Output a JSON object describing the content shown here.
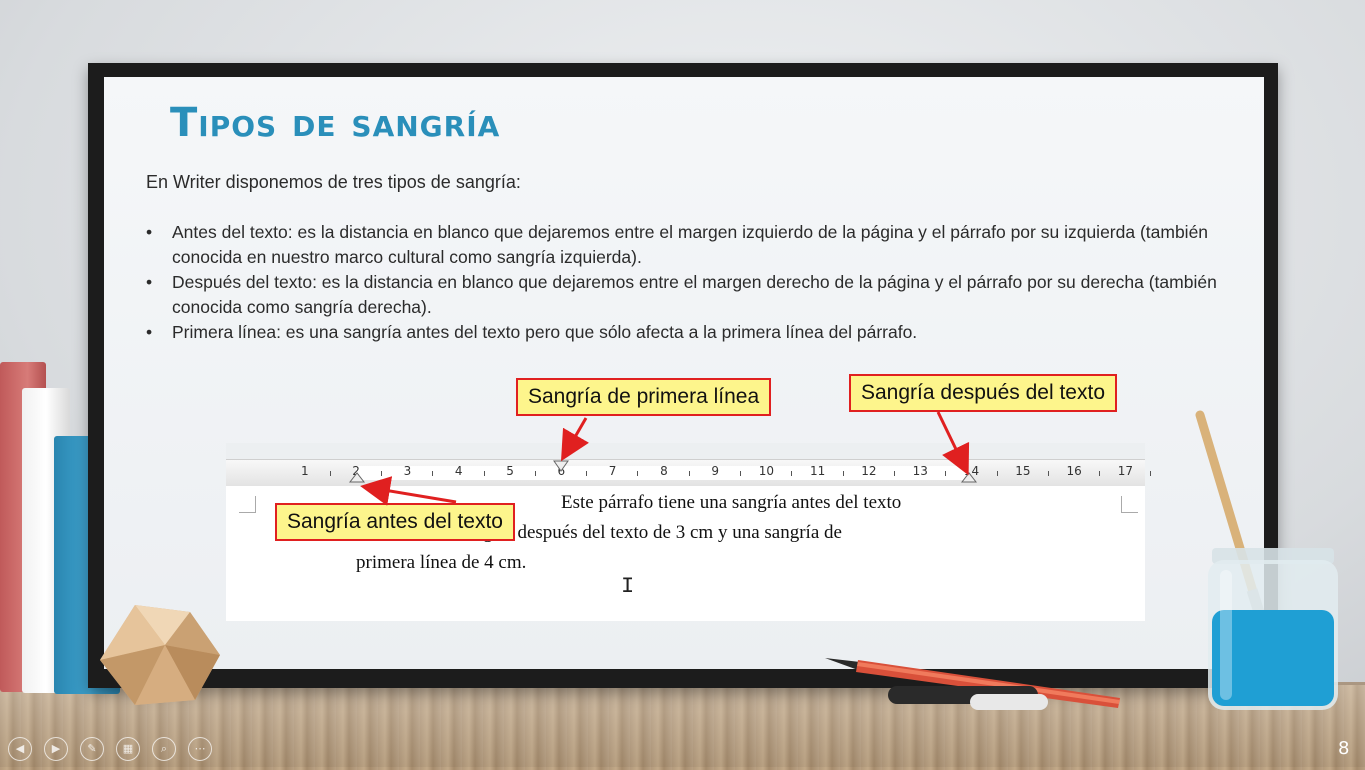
{
  "slide": {
    "title": "Tipos de sangría",
    "intro": "En Writer disponemos de tres tipos de sangría:",
    "bullets": [
      "Antes del texto: es la distancia en blanco que dejaremos entre el margen izquierdo de la página y el párrafo por su izquierda (también conocida en nuestro marco cultural como sangría izquierda).",
      "Después del texto: es la distancia en blanco que dejaremos entre el margen derecho de la página y el párrafo por su derecha (también conocida como sangría derecha).",
      "Primera línea: es una sangría antes del texto pero que sólo afecta a la primera línea del párrafo."
    ],
    "bullet_glyph": "•",
    "page_number": "8"
  },
  "figure": {
    "callouts": {
      "first_line": "Sangría de primera línea",
      "after_text": "Sangría después del texto",
      "before_text": "Sangría antes del texto"
    },
    "ruler_numbers": [
      "1",
      "2",
      "3",
      "4",
      "5",
      "6",
      "7",
      "8",
      "9",
      "10",
      "11",
      "12",
      "13",
      "14",
      "15",
      "16",
      "17"
    ],
    "document_lines": [
      "Este párrafo tiene una sangría antes del texto",
      "de 2 cm, una sangría después del texto de 3 cm y una sangría de",
      "primera línea de 4 cm."
    ],
    "text_cursor": "I",
    "callout_fill": "#fdf58c",
    "callout_border": "#e02020"
  },
  "nav_icons": [
    "arrow-left-icon",
    "arrow-right-icon",
    "pen-icon",
    "slides-icon",
    "zoom-icon",
    "more-icon"
  ],
  "nav_glyphs": [
    "◀",
    "▶",
    "✎",
    "▦",
    "⌕",
    "⋯"
  ],
  "colors": {
    "title": "#2a8fba",
    "board_frame": "#1c1c1c",
    "text": "#2b2b2b"
  }
}
